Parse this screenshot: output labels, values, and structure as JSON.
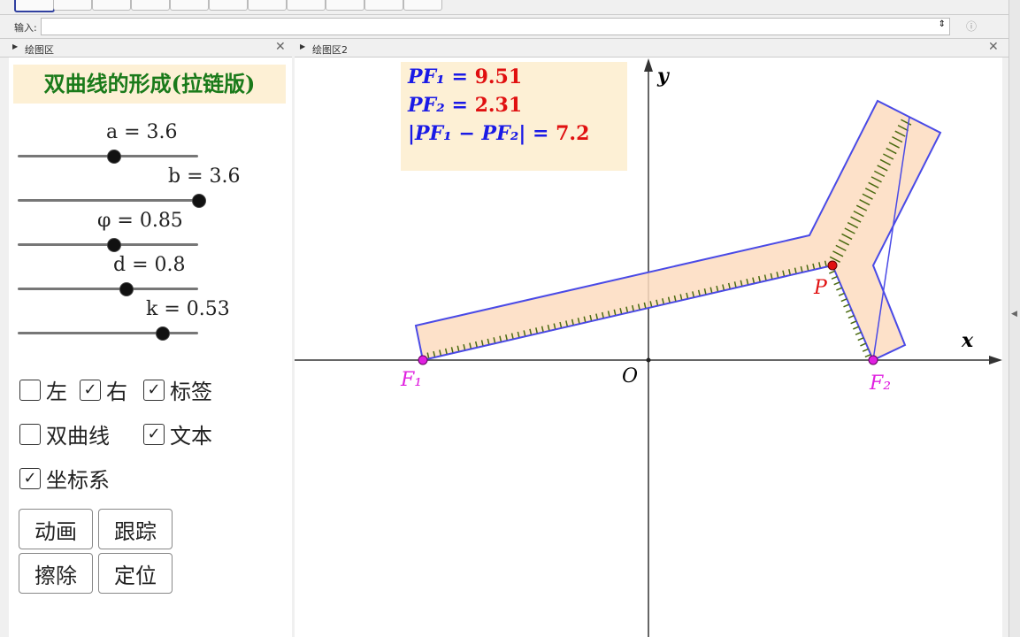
{
  "input_bar": {
    "label": "输入:"
  },
  "panels": {
    "left_title": "绘图区",
    "right_title": "绘图区2",
    "close": "✕"
  },
  "title": "双曲线的形成(拉链版)",
  "sliders": [
    {
      "name": "a",
      "label": "a = 3.6",
      "value": 3.6,
      "fraction": 0.53
    },
    {
      "name": "b",
      "label": "b = 3.6",
      "value": 3.6,
      "fraction": 1.0
    },
    {
      "name": "phi",
      "label": "φ = 0.85",
      "value": 0.85,
      "fraction": 0.53
    },
    {
      "name": "d",
      "label": "d = 0.8",
      "value": 0.8,
      "fraction": 0.6
    },
    {
      "name": "k",
      "label": "k = 0.53",
      "value": 0.53,
      "fraction": 0.8
    }
  ],
  "checkboxes": [
    {
      "label": "左",
      "checked": false
    },
    {
      "label": "右",
      "checked": true
    },
    {
      "label": "标签",
      "checked": true
    },
    {
      "label": "双曲线",
      "checked": false
    },
    {
      "label": "文本",
      "checked": true
    },
    {
      "label": "坐标系",
      "checked": true
    }
  ],
  "buttons": [
    "动画",
    "跟踪",
    "擦除",
    "定位"
  ],
  "info": {
    "pf1_label": "PF₁ = ",
    "pf1": "9.51",
    "pf2_label": "PF₂ = ",
    "pf2": "2.31",
    "diff_label": "|PF₁ − PF₂| = ",
    "diff": "7.2"
  },
  "graph": {
    "x_axis": "x",
    "y_axis": "y",
    "origin": "O",
    "F1": "F₁",
    "F2": "F₂",
    "P": "P"
  },
  "colors": {
    "title_green": "#1a7a1a",
    "blue": "#1a1ae6",
    "red": "#e01010",
    "fill": "#fddcbf",
    "focus": "#e020e0"
  }
}
